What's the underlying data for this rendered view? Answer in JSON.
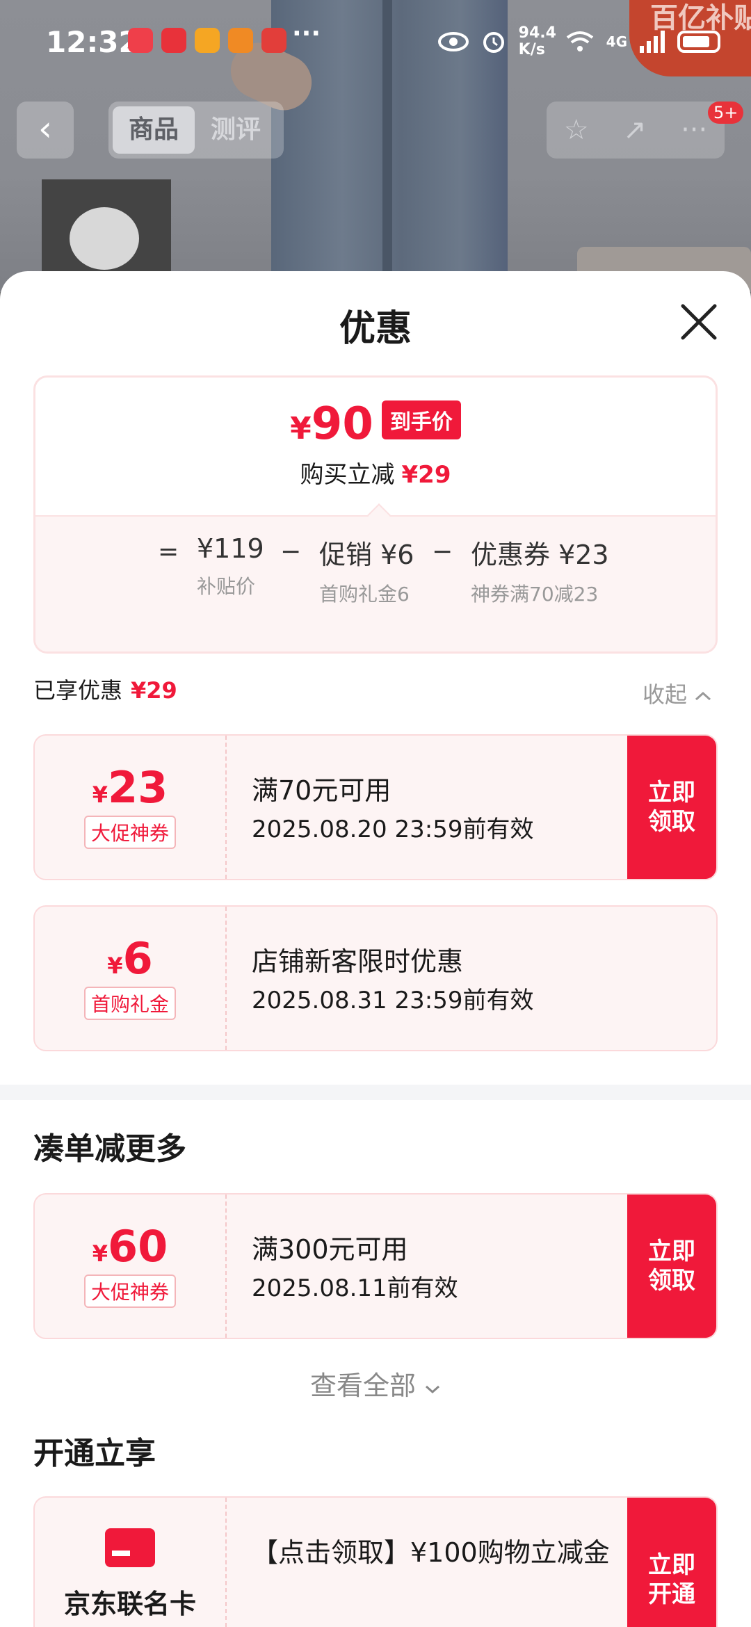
{
  "status_bar": {
    "time": "12:32",
    "net_speed": "94.4 K/s",
    "signal": "4G"
  },
  "background": {
    "subsidy_badge": "百亿补贴",
    "tabs": [
      "商品",
      "测评"
    ],
    "notification_count": "5+"
  },
  "sheet": {
    "title": "优惠",
    "summary": {
      "final_price_symbol": "¥",
      "final_price": "90",
      "final_price_tag": "到手价",
      "reduce_label": "购买立减",
      "reduce_amount": "¥29",
      "formula": {
        "equals": "=",
        "minus": "−",
        "base_value": "¥119",
        "base_label": "补贴价",
        "promo_value": "促销 ¥6",
        "promo_label": "首购礼金6",
        "coupon_value": "优惠券 ¥23",
        "coupon_label": "神券满70减23"
      }
    },
    "enjoyed_label": "已享优惠",
    "enjoyed_amount": "¥29",
    "collapse_label": "收起",
    "coupons": [
      {
        "yen": "¥",
        "amount": "23",
        "type": "大促神券",
        "condition": "满70元可用",
        "validity": "2025.08.20 23:59前有效",
        "action": "立即领取"
      },
      {
        "yen": "¥",
        "amount": "6",
        "type": "首购礼金",
        "condition": "店铺新客限时优惠",
        "validity": "2025.08.31 23:59前有效",
        "action": ""
      }
    ],
    "more_section": {
      "title": "凑单减更多",
      "coupon": {
        "yen": "¥",
        "amount": "60",
        "type": "大促神券",
        "condition": "满300元可用",
        "validity": "2025.08.11前有效",
        "action": "立即领取"
      },
      "view_all": "查看全部"
    },
    "open_section": {
      "title": "开通立享",
      "card": {
        "name": "京东联名卡",
        "description": "【点击领取】¥100购物立减金",
        "action": "立即开通"
      }
    }
  },
  "colors": {
    "accent": "#f0193a",
    "card_bg": "#fdf4f4"
  }
}
